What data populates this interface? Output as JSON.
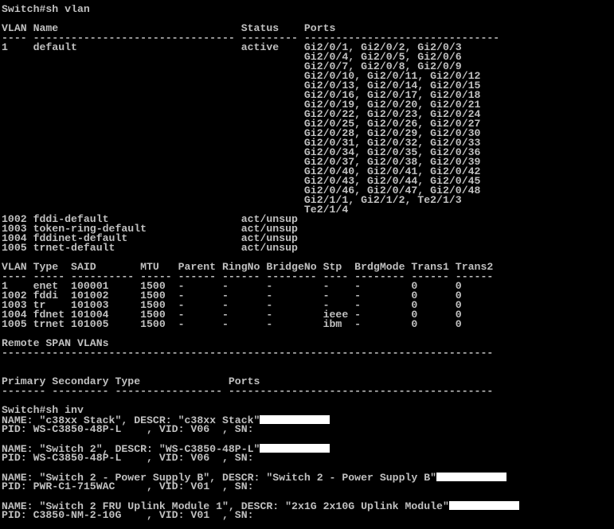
{
  "terminal": {
    "lines": [
      "Switch#sh vlan",
      "",
      "VLAN Name                             Status    Ports",
      "---- -------------------------------- --------- -------------------------------",
      "1    default                          active    Gi2/0/1, Gi2/0/2, Gi2/0/3",
      "                                                Gi2/0/4, Gi2/0/5, Gi2/0/6",
      "                                                Gi2/0/7, Gi2/0/8, Gi2/0/9",
      "                                                Gi2/0/10, Gi2/0/11, Gi2/0/12",
      "                                                Gi2/0/13, Gi2/0/14, Gi2/0/15",
      "                                                Gi2/0/16, Gi2/0/17, Gi2/0/18",
      "                                                Gi2/0/19, Gi2/0/20, Gi2/0/21",
      "                                                Gi2/0/22, Gi2/0/23, Gi2/0/24",
      "                                                Gi2/0/25, Gi2/0/26, Gi2/0/27",
      "                                                Gi2/0/28, Gi2/0/29, Gi2/0/30",
      "                                                Gi2/0/31, Gi2/0/32, Gi2/0/33",
      "                                                Gi2/0/34, Gi2/0/35, Gi2/0/36",
      "                                                Gi2/0/37, Gi2/0/38, Gi2/0/39",
      "                                                Gi2/0/40, Gi2/0/41, Gi2/0/42",
      "                                                Gi2/0/43, Gi2/0/44, Gi2/0/45",
      "                                                Gi2/0/46, Gi2/0/47, Gi2/0/48",
      "                                                Gi2/1/1, Gi2/1/2, Te2/1/3",
      "                                                Te2/1/4",
      "1002 fddi-default                     act/unsup",
      "1003 token-ring-default               act/unsup",
      "1004 fddinet-default                  act/unsup",
      "1005 trnet-default                    act/unsup",
      "",
      "VLAN Type  SAID       MTU   Parent RingNo BridgeNo Stp  BrdgMode Trans1 Trans2",
      "---- ----- ---------- ----- ------ ------ -------- ---- -------- ------ ------",
      "1    enet  100001     1500  -      -      -        -    -        0      0",
      "1002 fddi  101002     1500  -      -      -        -    -        0      0",
      "1003 tr    101003     1500  -      -      -        -    -        0      0",
      "1004 fdnet 101004     1500  -      -      -        ieee -        0      0",
      "1005 trnet 101005     1500  -      -      -        ibm  -        0      0",
      "",
      "Remote SPAN VLANs",
      "------------------------------------------------------------------------------",
      "",
      "",
      "Primary Secondary Type              Ports",
      "------- --------- ----------------- ------------------------------------------",
      "",
      "Switch#sh inv",
      "NAME: \"c38xx Stack\", DESCR: \"c38xx Stack\"",
      "PID: WS-C3850-48P-L    , VID: V06  , SN: ",
      "",
      "NAME: \"Switch 2\", DESCR: \"WS-C3850-48P-L\"",
      "PID: WS-C3850-48P-L    , VID: V06  , SN: ",
      "",
      "NAME: \"Switch 2 - Power Supply B\", DESCR: \"Switch 2 - Power Supply B\"",
      "PID: PWR-C1-715WAC     , VID: V01  , SN: ",
      "",
      "NAME: \"Switch 2 FRU Uplink Module 1\", DESCR: \"2x1G 2x10G Uplink Module\"",
      "PID: C3850-NM-2-10G    , VID: V01  , SN: "
    ],
    "redacted_line_indexes": [
      43,
      46,
      49,
      52
    ]
  }
}
